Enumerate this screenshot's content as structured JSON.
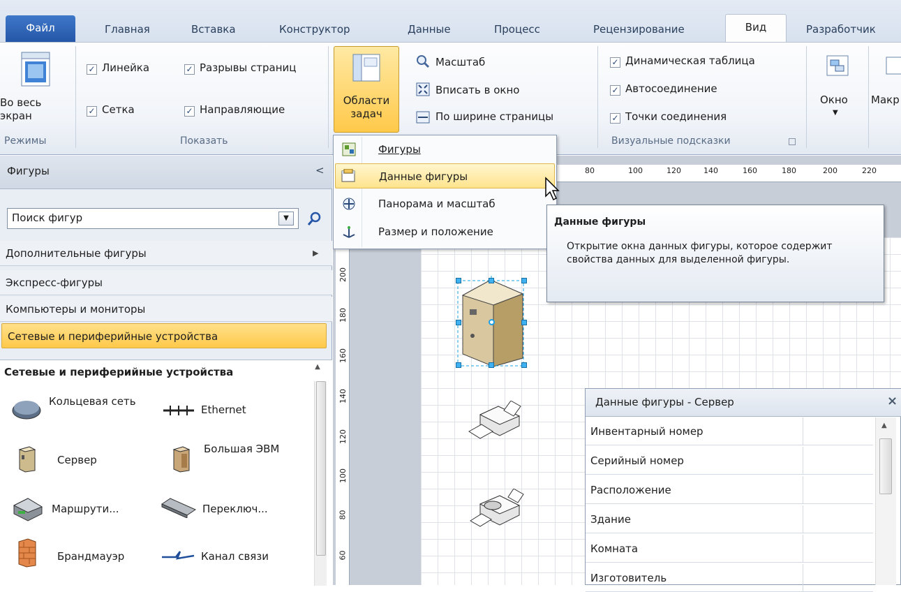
{
  "tabs": [
    {
      "label": "Файл"
    },
    {
      "label": "Главная"
    },
    {
      "label": "Вставка"
    },
    {
      "label": "Конструктор"
    },
    {
      "label": "Данные"
    },
    {
      "label": "Процесс"
    },
    {
      "label": "Рецензирование"
    },
    {
      "label": "Вид"
    },
    {
      "label": "Разработчик"
    }
  ],
  "ribbon": {
    "modes": {
      "fullscreen_label": "Во весь экран",
      "group_label": "Режимы"
    },
    "show": {
      "ruler": "Линейка",
      "page_breaks": "Разрывы страниц",
      "grid": "Сетка",
      "guides": "Направляющие",
      "group_label": "Показать"
    },
    "taskpanes": {
      "label": "Области задач"
    },
    "zoom": {
      "zoom": "Масштаб",
      "fit": "Вписать в окно",
      "page_width": "По ширине страницы"
    },
    "visual_aids": {
      "dynamic_grid": "Динамическая таблица",
      "autoconnect": "Автосоединение",
      "connection_points": "Точки соединения",
      "group_label": "Визуальные подсказки"
    },
    "window_label": "Окно",
    "macros_label": "Макр"
  },
  "shapes_panel": {
    "title": "Фигуры",
    "collapse": "<",
    "search_placeholder": "Поиск фигур",
    "categories": [
      {
        "label": "Дополнительные фигуры"
      },
      {
        "label": "Экспресс-фигуры"
      },
      {
        "label": "Компьютеры и мониторы"
      },
      {
        "label": "Сетевые и периферийные устройства"
      }
    ],
    "stencil_title": "Сетевые и периферийные устройства",
    "shapes": [
      {
        "label": "Кольцевая сеть"
      },
      {
        "label": "Ethernet"
      },
      {
        "label": "Сервер"
      },
      {
        "label": "Большая ЭВМ"
      },
      {
        "label": "Маршрути..."
      },
      {
        "label": "Переключ..."
      },
      {
        "label": "Брандмауэр"
      },
      {
        "label": "Канал связи"
      }
    ]
  },
  "taskpane_menu": {
    "items": [
      {
        "label": "Фигуры"
      },
      {
        "label": "Данные фигуры"
      },
      {
        "label": "Панорама и масштаб"
      },
      {
        "label": "Размер и положение"
      }
    ]
  },
  "tooltip": {
    "title": "Данные фигуры",
    "body": "Открытие окна данных фигуры, которое содержит свойства данных для выделенной фигуры."
  },
  "shape_data_window": {
    "title": "Данные фигуры - Сервер",
    "close": "×",
    "rows": [
      {
        "label": "Инвентарный номер"
      },
      {
        "label": "Серийный номер"
      },
      {
        "label": "Расположение"
      },
      {
        "label": "Здание"
      },
      {
        "label": "Комната"
      },
      {
        "label": "Изготовитель"
      }
    ]
  },
  "hruler_ticks": [
    "80",
    "100",
    "120",
    "140",
    "160",
    "180",
    "200",
    "220"
  ],
  "vruler_ticks": [
    "200",
    "180",
    "160",
    "140",
    "120",
    "100",
    "80",
    "60"
  ]
}
